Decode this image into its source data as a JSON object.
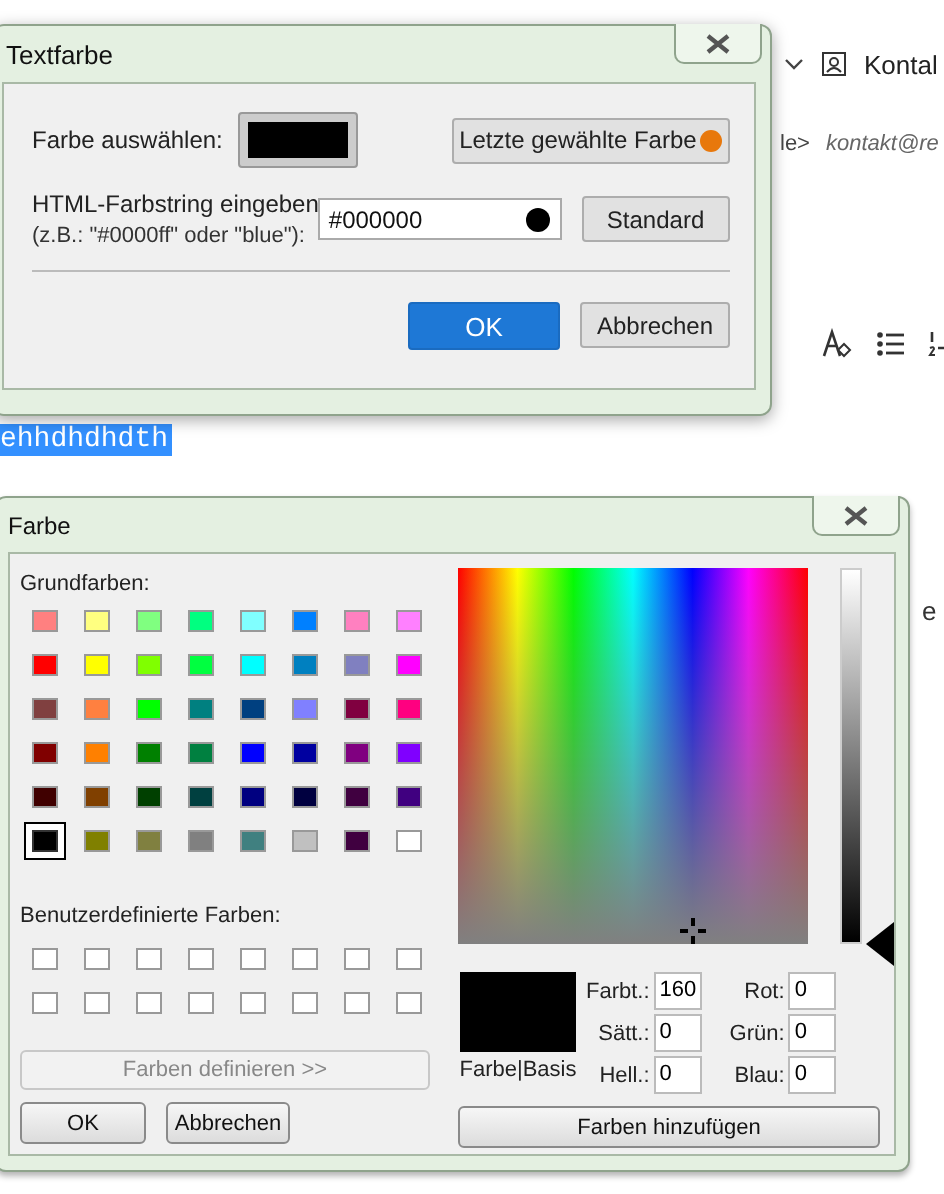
{
  "background_app": {
    "toolbar_label": "Kontal",
    "sender_suffix": "le>",
    "address": "kontakt@re",
    "selected_text": "ehhdhdhdth",
    "side_text": "e"
  },
  "text_color_dialog": {
    "title": "Textfarbe",
    "choose_label": "Farbe auswählen:",
    "recent_button": {
      "label": "Letzte gewählte Farbe",
      "color": "#e8780c"
    },
    "html_label": "HTML-Farbstring eingeben",
    "html_hint": "(z.B.: \"#0000ff\" oder \"blue\"):",
    "html_value": "#000000",
    "default_button": "Standard",
    "ok_button": "OK",
    "cancel_button": "Abbrechen"
  },
  "color_dialog": {
    "title": "Farbe",
    "basic_label": "Grundfarben:",
    "basic_colors": [
      {
        "color": "#ff8080",
        "selected": false
      },
      {
        "color": "#ffff80",
        "selected": false
      },
      {
        "color": "#80ff80",
        "selected": false
      },
      {
        "color": "#00ff80",
        "selected": false
      },
      {
        "color": "#80ffff",
        "selected": false
      },
      {
        "color": "#0080ff",
        "selected": false
      },
      {
        "color": "#ff80c0",
        "selected": false
      },
      {
        "color": "#ff80ff",
        "selected": false
      },
      {
        "color": "#ff0000",
        "selected": false
      },
      {
        "color": "#ffff00",
        "selected": false
      },
      {
        "color": "#80ff00",
        "selected": false
      },
      {
        "color": "#00ff40",
        "selected": false
      },
      {
        "color": "#00ffff",
        "selected": false
      },
      {
        "color": "#0080c0",
        "selected": false
      },
      {
        "color": "#8080c0",
        "selected": false
      },
      {
        "color": "#ff00ff",
        "selected": false
      },
      {
        "color": "#804040",
        "selected": false
      },
      {
        "color": "#ff8040",
        "selected": false
      },
      {
        "color": "#00ff00",
        "selected": false
      },
      {
        "color": "#008080",
        "selected": false
      },
      {
        "color": "#004080",
        "selected": false
      },
      {
        "color": "#8080ff",
        "selected": false
      },
      {
        "color": "#800040",
        "selected": false
      },
      {
        "color": "#ff0080",
        "selected": false
      },
      {
        "color": "#800000",
        "selected": false
      },
      {
        "color": "#ff8000",
        "selected": false
      },
      {
        "color": "#008000",
        "selected": false
      },
      {
        "color": "#008040",
        "selected": false
      },
      {
        "color": "#0000ff",
        "selected": false
      },
      {
        "color": "#0000a0",
        "selected": false
      },
      {
        "color": "#800080",
        "selected": false
      },
      {
        "color": "#8000ff",
        "selected": false
      },
      {
        "color": "#400000",
        "selected": false
      },
      {
        "color": "#804000",
        "selected": false
      },
      {
        "color": "#004000",
        "selected": false
      },
      {
        "color": "#004040",
        "selected": false
      },
      {
        "color": "#000080",
        "selected": false
      },
      {
        "color": "#000040",
        "selected": false
      },
      {
        "color": "#400040",
        "selected": false
      },
      {
        "color": "#400080",
        "selected": false
      },
      {
        "color": "#000000",
        "selected": true
      },
      {
        "color": "#808000",
        "selected": false
      },
      {
        "color": "#808040",
        "selected": false
      },
      {
        "color": "#808080",
        "selected": false
      },
      {
        "color": "#408080",
        "selected": false
      },
      {
        "color": "#c0c0c0",
        "selected": false
      },
      {
        "color": "#400040",
        "selected": false
      },
      {
        "color": "#ffffff",
        "selected": false
      }
    ],
    "custom_label": "Benutzerdefinierte Farben:",
    "custom_colors": [
      {
        "color": "#ffffff"
      },
      {
        "color": "#ffffff"
      },
      {
        "color": "#ffffff"
      },
      {
        "color": "#ffffff"
      },
      {
        "color": "#ffffff"
      },
      {
        "color": "#ffffff"
      },
      {
        "color": "#ffffff"
      },
      {
        "color": "#ffffff"
      },
      {
        "color": "#ffffff"
      },
      {
        "color": "#ffffff"
      },
      {
        "color": "#ffffff"
      },
      {
        "color": "#ffffff"
      },
      {
        "color": "#ffffff"
      },
      {
        "color": "#ffffff"
      },
      {
        "color": "#ffffff"
      },
      {
        "color": "#ffffff"
      }
    ],
    "define_button": {
      "label": "Farben definieren >>",
      "disabled": true
    },
    "ok_button": "OK",
    "cancel_button": "Abbrechen",
    "luminance": {
      "level": 0
    },
    "preview_label": "Farbe|Basis",
    "fields_left": [
      {
        "label": "Farbt.:",
        "value": "160"
      },
      {
        "label": "Sätt.:",
        "value": "0"
      },
      {
        "label": "Hell.:",
        "value": "0"
      }
    ],
    "fields_right": [
      {
        "label": "Rot:",
        "value": "0"
      },
      {
        "label": "Grün:",
        "value": "0"
      },
      {
        "label": "Blau:",
        "value": "0"
      }
    ],
    "add_button": "Farben hinzufügen"
  }
}
